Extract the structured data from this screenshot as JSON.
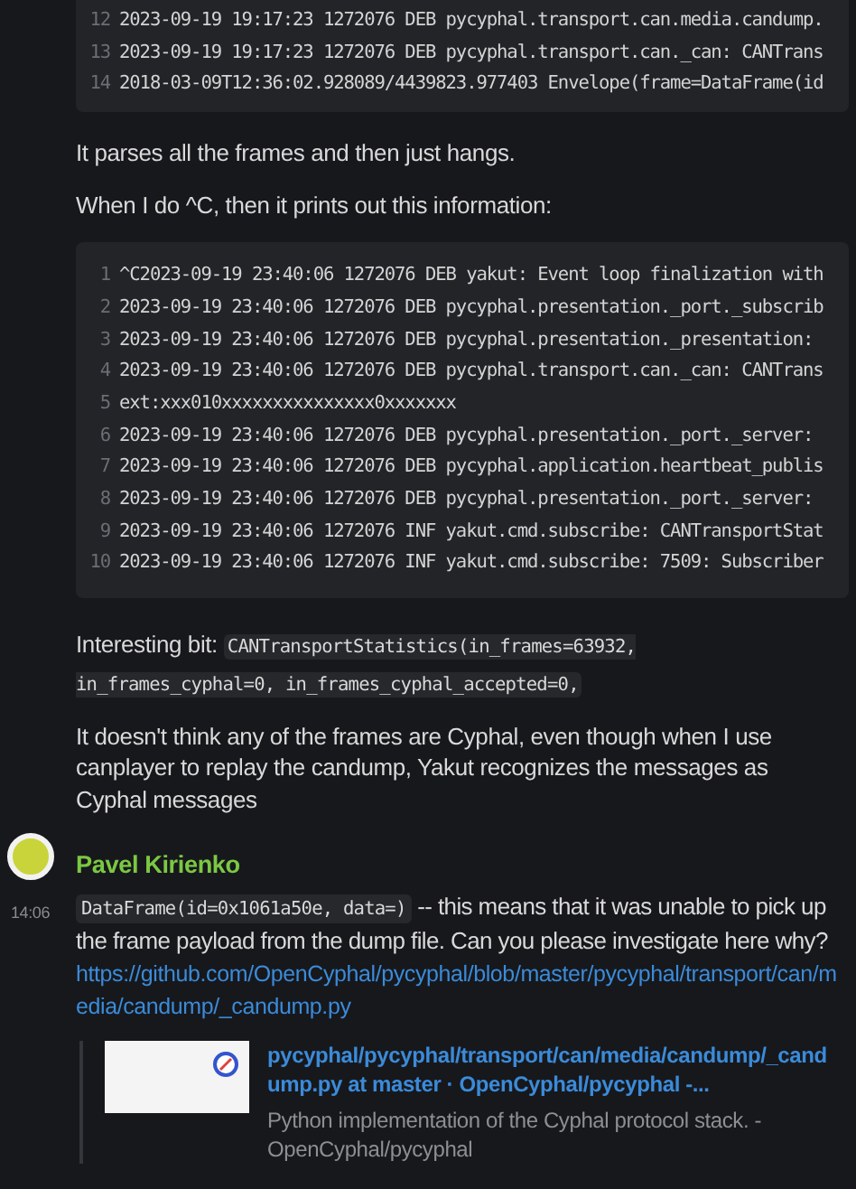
{
  "code_block_top": {
    "lines": [
      {
        "number": "12",
        "text": "2023-09-19 19:17:23 1272076 DEB pycyphal.transport.can.media.candump."
      },
      {
        "number": "13",
        "text": "2023-09-19 19:17:23 1272076 DEB pycyphal.transport.can._can: CANTrans"
      },
      {
        "number": "14",
        "text": "2018-03-09T12:36:02.928089/4439823.977403 Envelope(frame=DataFrame(id"
      }
    ]
  },
  "paragraphs": [
    "It parses all the frames and then just hangs.",
    "When I do ^C, then it prints out this information:"
  ],
  "code_block": {
    "lines": [
      {
        "number": "1",
        "text": "^C2023-09-19 23:40:06 1272076 DEB yakut: Event loop finalization with"
      },
      {
        "number": "2",
        "text": "2023-09-19 23:40:06 1272076 DEB pycyphal.presentation._port._subscrib"
      },
      {
        "number": "3",
        "text": "2023-09-19 23:40:06 1272076 DEB pycyphal.presentation._presentation:"
      },
      {
        "number": "4",
        "text": "2023-09-19 23:40:06 1272076 DEB pycyphal.transport.can._can: CANTrans"
      },
      {
        "number": "5",
        "text": "ext:xxx010xxxxxxxxxxxxxxx0xxxxxxx"
      },
      {
        "number": "6",
        "text": "2023-09-19 23:40:06 1272076 DEB pycyphal.presentation._port._server:"
      },
      {
        "number": "7",
        "text": "2023-09-19 23:40:06 1272076 DEB pycyphal.application.heartbeat_publis"
      },
      {
        "number": "8",
        "text": "2023-09-19 23:40:06 1272076 DEB pycyphal.presentation._port._server:"
      },
      {
        "number": "9",
        "text": "2023-09-19 23:40:06 1272076 INF yakut.cmd.subscribe: CANTransportStat"
      },
      {
        "number": "10",
        "text": "2023-09-19 23:40:06 1272076 INF yakut.cmd.subscribe: 7509: Subscriber"
      }
    ]
  },
  "interesting": {
    "lead": "Interesting bit:",
    "code": "CANTransportStatistics(in_frames=63932, in_frames_cyphal=0, in_frames_cyphal_accepted=0,"
  },
  "closing_paragraph": "It doesn't think any of the frames are Cyphal, even though when I use canplayer to replay the candump, Yakut recognizes the messages as Cyphal messages",
  "reply": {
    "author": "Pavel Kirienko",
    "time": "14:06",
    "code": "DataFrame(id=0x1061a50e, data=)",
    "text": "-- this means that it was unable to pick up the frame payload from the dump file. Can you please investigate here why?",
    "link": "https://github.com/OpenCyphal/pycyphal/blob/master/pycyphal/transport/can/media/candump/_candump.py",
    "preview": {
      "title": "pycyphal/pycyphal/transport/can/media/candump/_candump.py at master · OpenCyphal/pycyphal -...",
      "description": "Python implementation of the Cyphal protocol stack. - OpenCyphal/pycyphal"
    }
  }
}
